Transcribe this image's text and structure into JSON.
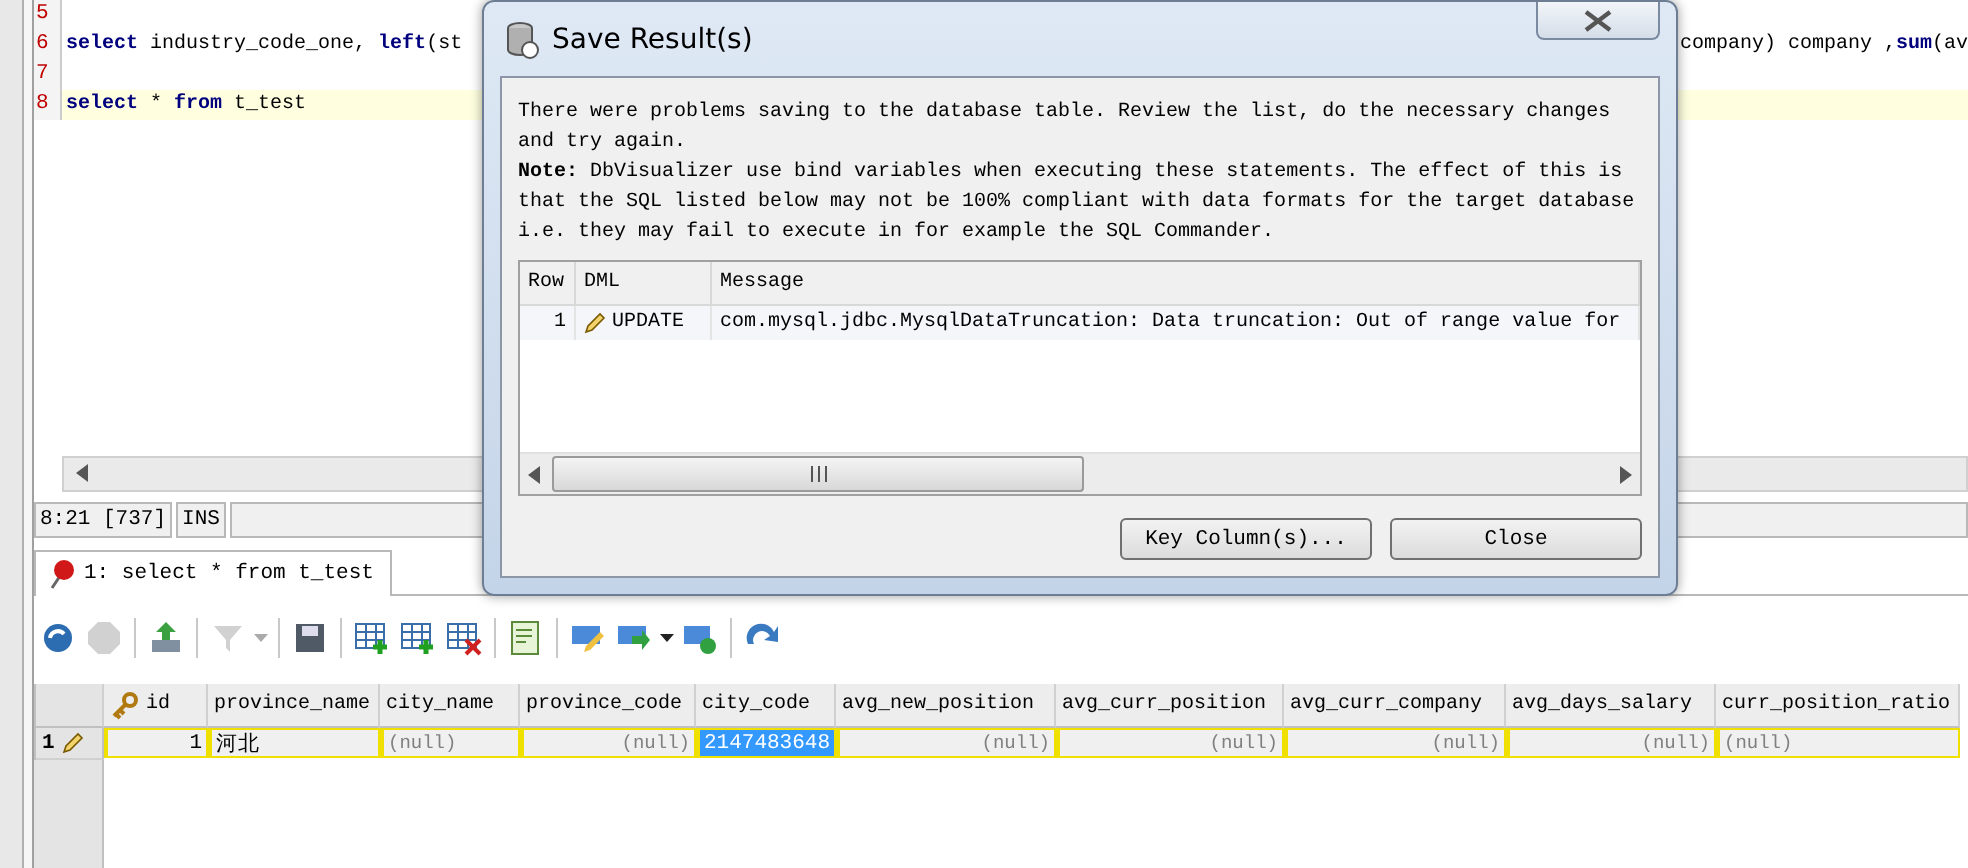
{
  "editor": {
    "lines": [
      {
        "number": "5",
        "current": false
      },
      {
        "number": "6",
        "current": false,
        "left": [
          {
            "kind": "keyword",
            "text": "select"
          },
          {
            "kind": "plain",
            "text": " industry_code_one, "
          },
          {
            "kind": "keyword",
            "text": "left"
          },
          {
            "kind": "plain",
            "text": "(st"
          }
        ],
        "right": [
          {
            "kind": "plain",
            "text": "company) company ,"
          },
          {
            "kind": "keyword",
            "text": "sum"
          },
          {
            "kind": "plain",
            "text": "(av"
          }
        ]
      },
      {
        "number": "7",
        "current": false
      },
      {
        "number": "8",
        "current": true,
        "left": [
          {
            "kind": "keyword",
            "text": "select"
          },
          {
            "kind": "plain",
            "text": " * "
          },
          {
            "kind": "keyword",
            "text": "from"
          },
          {
            "kind": "plain",
            "text": " t_test"
          }
        ]
      }
    ]
  },
  "status_bar": {
    "position": "8:21 [737]",
    "mode": "INS"
  },
  "result_tabs": [
    {
      "label": "1: select * from t_test",
      "selected": true
    }
  ],
  "toolbar": [
    {
      "kind": "refresh",
      "disabled": false
    },
    {
      "kind": "stop",
      "disabled": true
    },
    {
      "kind": "export",
      "disabled": false
    },
    {
      "kind": "filter",
      "disabled": true
    },
    {
      "kind": "save",
      "disabled": false
    },
    {
      "kind": "add-row",
      "disabled": false
    },
    {
      "kind": "copy-row",
      "disabled": false
    },
    {
      "kind": "delete-row",
      "disabled": false
    },
    {
      "kind": "edit-form",
      "disabled": false
    },
    {
      "kind": "edit",
      "disabled": false
    },
    {
      "kind": "apply",
      "disabled": false
    },
    {
      "kind": "commit",
      "disabled": false
    },
    {
      "kind": "undo",
      "disabled": false
    }
  ],
  "grid": {
    "columns": [
      {
        "label": "id",
        "key": true,
        "kind": "number"
      },
      {
        "label": "province_name",
        "key": false,
        "kind": "text"
      },
      {
        "label": "city_name",
        "key": false,
        "kind": "text"
      },
      {
        "label": "province_code",
        "key": false,
        "kind": "number"
      },
      {
        "label": "city_code",
        "key": false,
        "kind": "number"
      },
      {
        "label": "avg_new_position",
        "key": false,
        "kind": "number"
      },
      {
        "label": "avg_curr_position",
        "key": false,
        "kind": "number"
      },
      {
        "label": "avg_curr_company",
        "key": false,
        "kind": "number"
      },
      {
        "label": "avg_days_salary",
        "key": false,
        "kind": "number"
      },
      {
        "label": "curr_position_ratio",
        "key": false,
        "kind": "text"
      }
    ],
    "rows": [
      {
        "number": "1",
        "edited": true,
        "cells": [
          {
            "text": "1",
            "null": false,
            "selected": false
          },
          {
            "text": "河北",
            "null": false,
            "selected": false
          },
          {
            "text": "(null)",
            "null": true,
            "selected": false
          },
          {
            "text": "(null)",
            "null": true,
            "selected": false
          },
          {
            "text": "2147483648",
            "null": false,
            "selected": true
          },
          {
            "text": "(null)",
            "null": true,
            "selected": false
          },
          {
            "text": "(null)",
            "null": true,
            "selected": false
          },
          {
            "text": "(null)",
            "null": true,
            "selected": false
          },
          {
            "text": "(null)",
            "null": true,
            "selected": false
          },
          {
            "text": "(null)",
            "null": true,
            "selected": false
          }
        ]
      }
    ]
  },
  "dialog": {
    "title": "Save Result(s)",
    "paragraphs": [
      "There were problems saving to the database table. Review the list, do the necessary changes and try again.",
      "**Note:** DbVisualizer use bind variables when executing these statements. The effect of this is that the SQL listed below may not be 100% compliant with data formats for the target database i.e. they may fail to execute in for example the SQL Commander."
    ],
    "table": {
      "columns": [
        "Row",
        "DML",
        "Message"
      ],
      "rows": [
        {
          "row": "1",
          "dml": "UPDATE",
          "message": "com.mysql.jdbc.MysqlDataTruncation: Data truncation: Out of range value for"
        }
      ]
    },
    "buttons": [
      "Key Column(s)...",
      "Close"
    ]
  }
}
